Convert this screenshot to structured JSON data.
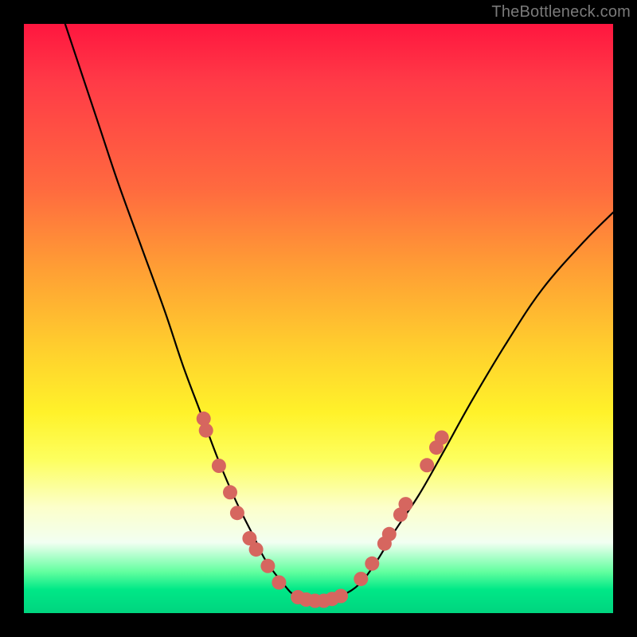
{
  "watermark": "TheBottleneck.com",
  "colors": {
    "curve_stroke": "#000000",
    "bead_fill": "#d6665f",
    "bead_stroke": "#c9584f",
    "axis_frame": "#000000"
  },
  "chart_data": {
    "type": "line",
    "title": "",
    "xlabel": "",
    "ylabel": "",
    "xlim": [
      0,
      100
    ],
    "ylim": [
      0,
      100
    ],
    "grid": false,
    "legend": false,
    "series": [
      {
        "name": "bottleneck-curve",
        "x": [
          7,
          10,
          13,
          16,
          20,
          24,
          27,
          30,
          33,
          36,
          39,
          41,
          44,
          46,
          49,
          51,
          54,
          57,
          60,
          63,
          67,
          71,
          76,
          82,
          88,
          95,
          100
        ],
        "y": [
          100,
          91,
          82,
          73,
          62,
          51,
          42,
          34,
          26,
          19,
          13,
          9,
          5,
          3,
          2,
          2,
          3,
          5,
          9,
          14,
          20,
          27,
          36,
          46,
          55,
          63,
          68
        ]
      }
    ],
    "beads_left": [
      {
        "x": 30.5,
        "y": 33
      },
      {
        "x": 30.9,
        "y": 31
      },
      {
        "x": 33.1,
        "y": 25
      },
      {
        "x": 35.0,
        "y": 20.5
      },
      {
        "x": 36.2,
        "y": 17
      },
      {
        "x": 38.3,
        "y": 12.7
      },
      {
        "x": 39.4,
        "y": 10.8
      },
      {
        "x": 41.4,
        "y": 8
      },
      {
        "x": 43.3,
        "y": 5.2
      }
    ],
    "beads_bottom": [
      {
        "x": 46.5,
        "y": 2.7
      },
      {
        "x": 47.9,
        "y": 2.3
      },
      {
        "x": 49.4,
        "y": 2.1
      },
      {
        "x": 50.9,
        "y": 2.1
      },
      {
        "x": 52.3,
        "y": 2.4
      },
      {
        "x": 53.8,
        "y": 2.9
      }
    ],
    "beads_right": [
      {
        "x": 57.2,
        "y": 5.8
      },
      {
        "x": 59.1,
        "y": 8.4
      },
      {
        "x": 61.2,
        "y": 11.8
      },
      {
        "x": 62.0,
        "y": 13.4
      },
      {
        "x": 63.9,
        "y": 16.7
      },
      {
        "x": 64.8,
        "y": 18.5
      },
      {
        "x": 68.4,
        "y": 25.1
      },
      {
        "x": 70.0,
        "y": 28.1
      },
      {
        "x": 70.9,
        "y": 29.8
      }
    ]
  }
}
